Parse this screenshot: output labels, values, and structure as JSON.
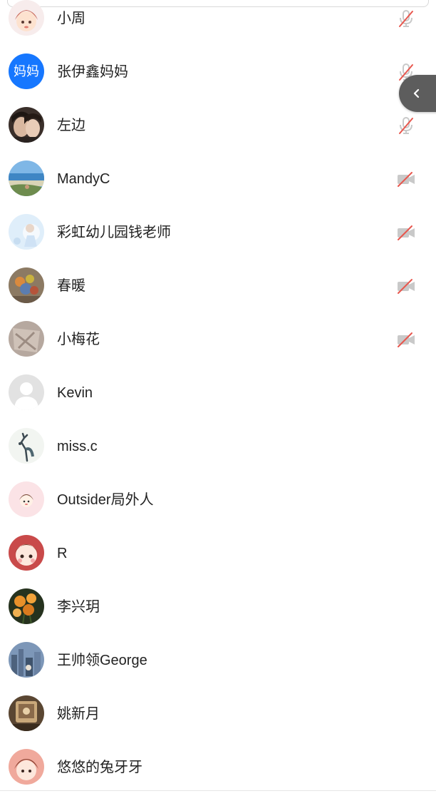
{
  "participants": [
    {
      "name": "小周",
      "avatar": "girl-cartoon",
      "status": "mic-muted"
    },
    {
      "name": "张伊鑫妈妈",
      "avatar": "text",
      "avatar_text": "妈妈",
      "avatar_color": "#1677ff",
      "status": "mic-muted"
    },
    {
      "name": "左边",
      "avatar": "couple-photo",
      "status": "mic-muted"
    },
    {
      "name": "MandyC",
      "avatar": "beach-photo",
      "status": "video-off"
    },
    {
      "name": "彩虹幼儿园钱老师",
      "avatar": "snow-photo",
      "status": "video-off"
    },
    {
      "name": "春暖",
      "avatar": "flowers-photo",
      "status": "video-off"
    },
    {
      "name": "小梅花",
      "avatar": "stone-photo",
      "status": "video-off"
    },
    {
      "name": "Kevin",
      "avatar": "default-user",
      "status": "none"
    },
    {
      "name": "miss.c",
      "avatar": "deer-illustration",
      "status": "none"
    },
    {
      "name": "Outsider局外人",
      "avatar": "pink-cartoon",
      "status": "none"
    },
    {
      "name": "R",
      "avatar": "red-cartoon",
      "status": "none"
    },
    {
      "name": "李兴玥",
      "avatar": "orange-flowers",
      "status": "none"
    },
    {
      "name": "王帅领George",
      "avatar": "city-photo",
      "status": "none"
    },
    {
      "name": "姚新月",
      "avatar": "vintage-photo",
      "status": "none"
    },
    {
      "name": "悠悠的兔牙牙",
      "avatar": "cartoon-girl",
      "status": "none"
    }
  ],
  "side_tab": {
    "icon": "chevron-left-icon"
  },
  "colors": {
    "muted_red": "#e8574e",
    "muted_gray": "#c9c9c9",
    "accent_blue": "#1677ff",
    "tab_bg": "#5d5d5d"
  }
}
